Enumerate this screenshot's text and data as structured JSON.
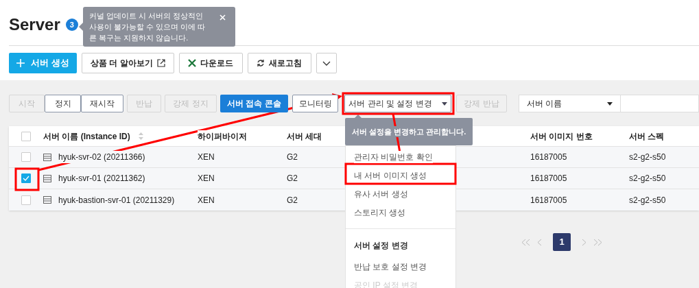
{
  "page": {
    "title": "Server",
    "count": "3"
  },
  "notice": {
    "text": "커널 업데이트 시 서버의 정상적인 사용이 불가능할 수 있으며 이에 따른 복구는 지원하지 않습니다."
  },
  "toolbar": [
    {
      "kind": "create",
      "label": "서버 생성"
    },
    {
      "kind": "external",
      "label": "상품 더 알아보기"
    },
    {
      "kind": "download",
      "label": "다운로드"
    },
    {
      "kind": "refresh",
      "label": "새로고침"
    },
    {
      "kind": "more"
    }
  ],
  "actions": [
    {
      "kind": "plain",
      "label": "시작",
      "disabled": true
    },
    {
      "kind": "plain",
      "label": "정지",
      "disabled": false
    },
    {
      "kind": "plain",
      "label": "재시작",
      "disabled": false
    },
    {
      "kind": "plain",
      "label": "반납",
      "disabled": true
    },
    {
      "kind": "plain",
      "label": "강제 정지",
      "disabled": true
    },
    {
      "kind": "primary",
      "label": "서버 접속 콘솔",
      "disabled": false
    },
    {
      "kind": "plain",
      "label": "모니터링",
      "disabled": false
    },
    {
      "kind": "dropdown",
      "label": "서버 관리 및 설정 변경",
      "disabled": false
    },
    {
      "kind": "plain",
      "label": "강제 반납",
      "disabled": true
    }
  ],
  "filter": {
    "field": "서버 이름"
  },
  "table": {
    "all_checked": false,
    "columns": [
      "서버 이름 (Instance ID)",
      "하이퍼바이저",
      "서버 세대",
      "서버 이미지 번호",
      "서버 스펙"
    ],
    "rows": [
      {
        "selected": false,
        "cells": [
          "hyuk-svr-02 (20211366)",
          "XEN",
          "G2",
          "16187005",
          "s2-g2-s50"
        ]
      },
      {
        "selected": true,
        "cells": [
          "hyuk-svr-01 (20211362)",
          "XEN",
          "G2",
          "16187005",
          "s2-g2-s50"
        ]
      },
      {
        "selected": false,
        "cells": [
          "hyuk-bastion-svr-01 (20211329)",
          "XEN",
          "G2",
          "16187005",
          "s2-g2-s50"
        ]
      }
    ]
  },
  "menu": {
    "tooltip": "서버 설정을 변경하고 관리합니다.",
    "sections": [
      {
        "items": [
          {
            "label": "관리자 비밀번호 확인",
            "disabled": false
          },
          {
            "label": "내 서버 이미지 생성",
            "disabled": false
          },
          {
            "label": "유사 서버 생성",
            "disabled": false
          },
          {
            "label": "스토리지 생성",
            "disabled": false
          }
        ]
      },
      {
        "heading": "서버 설정 변경",
        "items": [
          {
            "label": "반납 보호 설정 변경",
            "disabled": false
          },
          {
            "label": "공인 IP 설정 변경",
            "disabled": true
          }
        ]
      }
    ]
  },
  "pagination": {
    "pages": [
      {
        "label": "1",
        "selected": true
      }
    ]
  }
}
